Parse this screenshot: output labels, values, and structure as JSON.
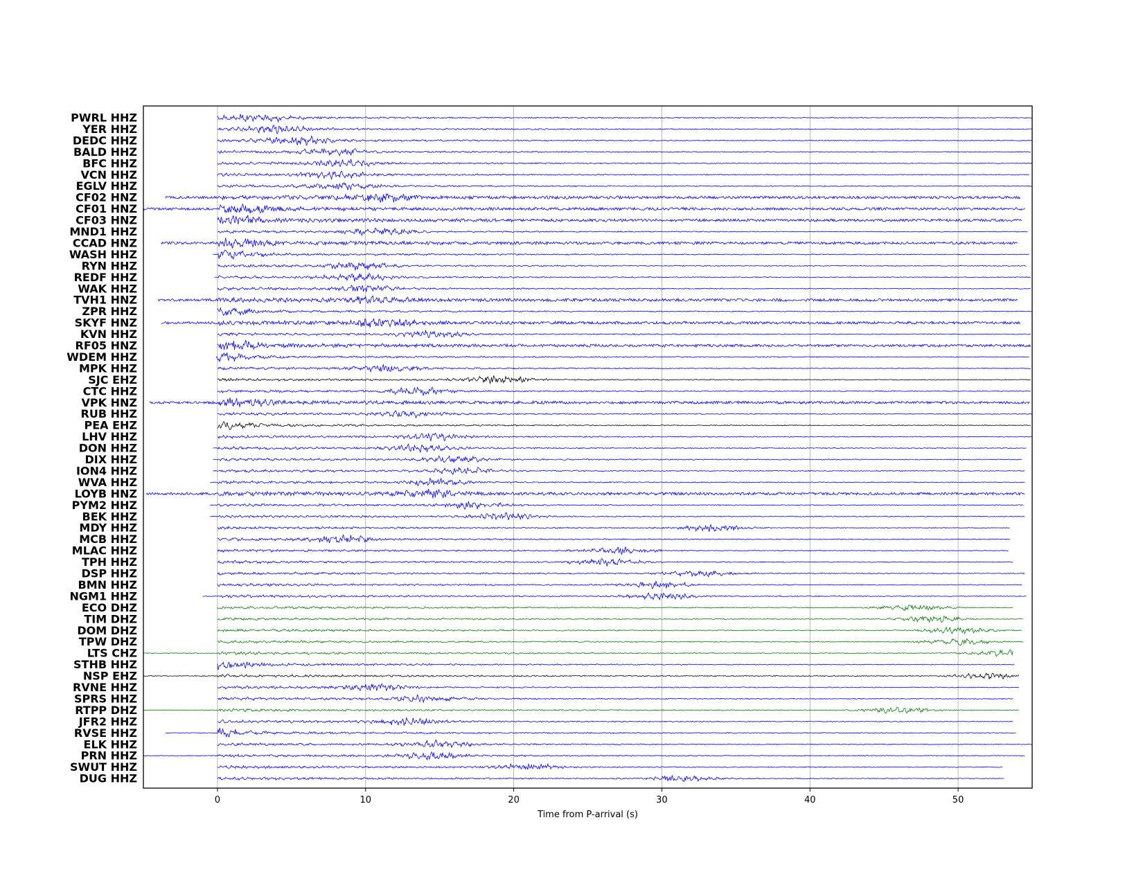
{
  "chart_data": {
    "type": "line",
    "xlabel": "Time from P-arrival (s)",
    "ylabel": "",
    "xlim": [
      -5,
      55
    ],
    "xticks": [
      0,
      10,
      20,
      30,
      40,
      50
    ],
    "grid": "vertical",
    "colors": {
      "HH": "#0000ff",
      "HN": "#0000ff",
      "EH": "#000000",
      "DH": "#008000",
      "CH": "#008000"
    },
    "traces": [
      {
        "station": "PWRL HHZ",
        "start": 0,
        "end": 55,
        "peak": 2.8
      },
      {
        "station": "YER HHZ",
        "start": 0,
        "end": 55,
        "peak": 3.8
      },
      {
        "station": "DEDC HHZ",
        "start": 0,
        "end": 55,
        "peak": 5.5
      },
      {
        "station": "BALD HHZ",
        "start": 0,
        "end": 54.9,
        "peak": 8
      },
      {
        "station": "BFC HHZ",
        "start": 0,
        "end": 55,
        "peak": 8.5
      },
      {
        "station": "VCN HHZ",
        "start": 0,
        "end": 54.8,
        "peak": 8
      },
      {
        "station": "EGLV HHZ",
        "start": 0,
        "end": 55,
        "peak": 8.5
      },
      {
        "station": "CF02 HNZ",
        "start": -3.5,
        "end": 54.2,
        "peak": 11
      },
      {
        "station": "CF01 HNZ",
        "start": -5,
        "end": 54.5,
        "peak": 1.5
      },
      {
        "station": "CF03 HNZ",
        "start": 0,
        "end": 54.3,
        "peak": 1
      },
      {
        "station": "MND1 HHZ",
        "start": 0,
        "end": 54.7,
        "peak": 11
      },
      {
        "station": "CCAD HNZ",
        "start": -3.8,
        "end": 54,
        "peak": 1
      },
      {
        "station": "WASH HHZ",
        "start": -0.3,
        "end": 54.8,
        "peak": 0.5
      },
      {
        "station": "RYN HHZ",
        "start": 0,
        "end": 54.6,
        "peak": 9.5
      },
      {
        "station": "REDF HHZ",
        "start": -0.2,
        "end": 54.9,
        "peak": 9.5
      },
      {
        "station": "WAK HHZ",
        "start": 0,
        "end": 54.9,
        "peak": 9.8
      },
      {
        "station": "TVH1 HNZ",
        "start": -4,
        "end": 54,
        "peak": 10.5
      },
      {
        "station": "ZPR HHZ",
        "start": 0,
        "end": 55,
        "peak": 0.3
      },
      {
        "station": "SKYF HNZ",
        "start": -3.8,
        "end": 54.2,
        "peak": 11
      },
      {
        "station": "KVN HHZ",
        "start": 0,
        "end": 54.9,
        "peak": 14.5
      },
      {
        "station": "RF05 HNZ",
        "start": 0,
        "end": 54.9,
        "peak": 0.8
      },
      {
        "station": "WDEM HHZ",
        "start": -0.1,
        "end": 54.8,
        "peak": 0.2
      },
      {
        "station": "MPK HHZ",
        "start": 0,
        "end": 54.9,
        "peak": 11.5
      },
      {
        "station": "SJC EHZ",
        "start": 0,
        "end": 54.9,
        "peak": 19
      },
      {
        "station": "CTC HHZ",
        "start": 0,
        "end": 54.9,
        "peak": 13.5
      },
      {
        "station": "VPK HNZ",
        "start": -4.6,
        "end": 54.8,
        "peak": 1.5
      },
      {
        "station": "RUB HHZ",
        "start": 0,
        "end": 55,
        "peak": 13
      },
      {
        "station": "PEA EHZ",
        "start": 0,
        "end": 54.9,
        "peak": 0.2
      },
      {
        "station": "LHV HHZ",
        "start": 0,
        "end": 55,
        "peak": 14.5
      },
      {
        "station": "DON HHZ",
        "start": -0.3,
        "end": 54.6,
        "peak": 13.8
      },
      {
        "station": "DIX HHZ",
        "start": -0.3,
        "end": 54.3,
        "peak": 16
      },
      {
        "station": "ION4 HHZ",
        "start": -0.3,
        "end": 54.5,
        "peak": 16.5
      },
      {
        "station": "WVA HHZ",
        "start": -0.5,
        "end": 54.5,
        "peak": 14.5
      },
      {
        "station": "LOYB HNZ",
        "start": -4.8,
        "end": 54.5,
        "peak": 14.2
      },
      {
        "station": "PYM2 HHZ",
        "start": -0.5,
        "end": 54.4,
        "peak": 17.5
      },
      {
        "station": "BEK HHZ",
        "start": -0.5,
        "end": 54.5,
        "peak": 19.3
      },
      {
        "station": "MDY HHZ",
        "start": 0,
        "end": 53.5,
        "peak": 33.5
      },
      {
        "station": "MCB HHZ",
        "start": 0,
        "end": 53.5,
        "peak": 8.5
      },
      {
        "station": "MLAC HHZ",
        "start": 0,
        "end": 53.4,
        "peak": 27
      },
      {
        "station": "TPH HHZ",
        "start": 0,
        "end": 53.7,
        "peak": 26.2
      },
      {
        "station": "DSP HHZ",
        "start": 0,
        "end": 54.5,
        "peak": 32.3
      },
      {
        "station": "BMN HHZ",
        "start": 0,
        "end": 54.3,
        "peak": 29.8
      },
      {
        "station": "NGM1 HHZ",
        "start": -1,
        "end": 54.6,
        "peak": 30
      },
      {
        "station": "ECO DHZ",
        "start": 0,
        "end": 53.7,
        "peak": 47
      },
      {
        "station": "TIM DHZ",
        "start": 0,
        "end": 54.4,
        "peak": 48.2
      },
      {
        "station": "DOM DHZ",
        "start": 0,
        "end": 54.3,
        "peak": 50
      },
      {
        "station": "TPW DHZ",
        "start": 0,
        "end": 54.4,
        "peak": 50
      },
      {
        "station": "LTS CHZ",
        "start": -5,
        "end": 53.7,
        "peak": 53.3
      },
      {
        "station": "STHB HHZ",
        "start": 0,
        "end": 53.8,
        "peak": 0.5
      },
      {
        "station": "NSP EHZ",
        "start": -5,
        "end": 54.1,
        "peak": 52
      },
      {
        "station": "RVNE HHZ",
        "start": 0,
        "end": 54.1,
        "peak": 10.7
      },
      {
        "station": "SPRS HHZ",
        "start": 0,
        "end": 53.7,
        "peak": 14
      },
      {
        "station": "RTPP DHZ",
        "start": -5,
        "end": 54.1,
        "peak": 46
      },
      {
        "station": "JFR2 HHZ",
        "start": 0,
        "end": 53.7,
        "peak": 13
      },
      {
        "station": "RVSE HHZ",
        "start": -3.5,
        "end": 53.9,
        "peak": -0.3
      },
      {
        "station": "ELK HHZ",
        "start": 0,
        "end": 55,
        "peak": 15
      },
      {
        "station": "PRN HHZ",
        "start": -5,
        "end": 54.5,
        "peak": 14.5
      },
      {
        "station": "SWUT HHZ",
        "start": 0,
        "end": 53,
        "peak": 21
      },
      {
        "station": "DUG HHZ",
        "start": 0,
        "end": 53.1,
        "peak": 31.5
      }
    ]
  }
}
